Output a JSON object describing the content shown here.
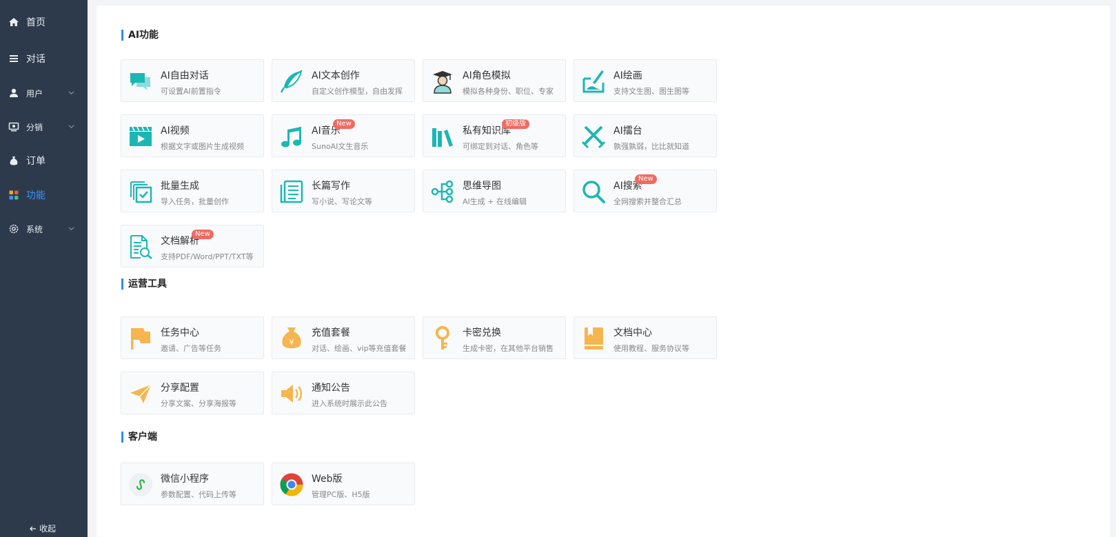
{
  "sidebar": {
    "items": [
      {
        "label": "首页",
        "icon": "home-icon"
      },
      {
        "label": "对话",
        "icon": "menu-icon"
      },
      {
        "label": "用户",
        "icon": "user-icon"
      },
      {
        "label": "分销",
        "icon": "distribution-icon"
      },
      {
        "label": "订单",
        "icon": "money-bag-icon"
      },
      {
        "label": "功能",
        "icon": "grid-icon"
      },
      {
        "label": "系统",
        "icon": "gear-icon"
      }
    ],
    "collapse_label": "收起",
    "active_color": "#3f93f7",
    "background": "#2d3a4b"
  },
  "sections": {
    "ai": {
      "title": "AI功能",
      "cards": [
        {
          "title": "AI自由对话",
          "desc": "可设置AI前置指令",
          "icon": "chat-bubbles-icon"
        },
        {
          "title": "AI文本创作",
          "desc": "自定义创作模型，自由发挥",
          "icon": "feather-icon"
        },
        {
          "title": "AI角色模拟",
          "desc": "模拟各种身份、职位、专家",
          "icon": "graduate-icon"
        },
        {
          "title": "AI绘画",
          "desc": "支持文生图、图生图等",
          "icon": "paint-icon"
        },
        {
          "title": "AI视频",
          "desc": "根据文字或图片生成视频",
          "icon": "video-icon"
        },
        {
          "title": "AI音乐",
          "desc": "SunoAI文生音乐",
          "icon": "music-note-icon",
          "badge": "New"
        },
        {
          "title": "私有知识库",
          "desc": "可绑定到对话、角色等",
          "icon": "books-icon",
          "badge": "初级版"
        },
        {
          "title": "AI擂台",
          "desc": "孰强孰弱，比比就知道",
          "icon": "crossed-swords-icon"
        },
        {
          "title": "批量生成",
          "desc": "导入任务，批量创作",
          "icon": "batch-check-icon"
        },
        {
          "title": "长篇写作",
          "desc": "写小说、写论文等",
          "icon": "document-lines-icon"
        },
        {
          "title": "思维导图",
          "desc": "AI生成 + 在线编辑",
          "icon": "mindmap-icon"
        },
        {
          "title": "AI搜索",
          "desc": "全网搜索并整合汇总",
          "icon": "search-icon",
          "badge": "New"
        },
        {
          "title": "文档解析",
          "desc": "支持PDF/Word/PPT/TXT等",
          "icon": "doc-search-icon",
          "badge": "New"
        }
      ]
    },
    "ops": {
      "title": "运营工具",
      "cards": [
        {
          "title": "任务中心",
          "desc": "邀请、广告等任务",
          "icon": "flag-icon"
        },
        {
          "title": "充值套餐",
          "desc": "对话、绘画、vip等充值套餐",
          "icon": "yen-bag-icon"
        },
        {
          "title": "卡密兑换",
          "desc": "生成卡密，在其他平台销售",
          "icon": "key-icon"
        },
        {
          "title": "文档中心",
          "desc": "使用教程、服务协议等",
          "icon": "book-icon"
        },
        {
          "title": "分享配置",
          "desc": "分享文案、分享海报等",
          "icon": "paper-plane-icon"
        },
        {
          "title": "通知公告",
          "desc": "进入系统时展示此公告",
          "icon": "speaker-icon"
        }
      ]
    },
    "client": {
      "title": "客户端",
      "cards": [
        {
          "title": "微信小程序",
          "desc": "参数配置、代码上传等",
          "icon": "miniprogram-icon"
        },
        {
          "title": "Web版",
          "desc": "管理PC版、H5版",
          "icon": "chrome-icon"
        }
      ]
    }
  },
  "colors": {
    "ai_icon": "#1bb7b5",
    "ops_icon": "#f5b54f",
    "badge": "#f06a62",
    "accent": "#2b8cf0"
  }
}
